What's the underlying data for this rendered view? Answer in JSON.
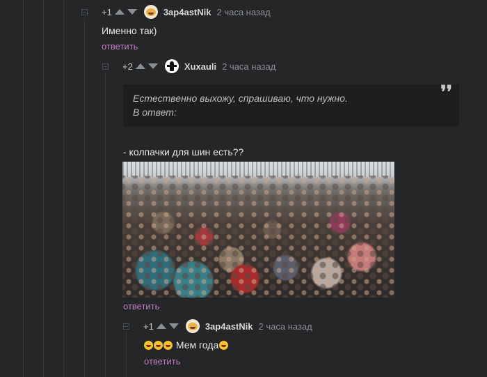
{
  "comments": [
    {
      "rating": "+1",
      "username": "3ap4astNik",
      "time": "2 часа назад",
      "text": "Именно так)",
      "reply_label": "ответить",
      "avatar_icon": "laughing-face-avatar"
    },
    {
      "rating": "+2",
      "username": "Xuxauli",
      "time": "2 часа назад",
      "quote_lines": [
        "Естественно выхожу, спрашиваю, что нужно.",
        "В ответ:"
      ],
      "quote_mark": "❜❜",
      "text": "- колпачки для шин есть??",
      "image_icon": "crowd-of-elderly-people-photo",
      "reply_label": "ответить",
      "avatar_icon": "figure-logo-avatar"
    },
    {
      "rating": "+1",
      "username": "3ap4astNik",
      "time": "2 часа назад",
      "text": "Мем года",
      "emojis": [
        "grinning-emoji",
        "grinning-emoji",
        "grinning-emoji",
        "laughing-tears-emoji"
      ],
      "reply_label": "ответить",
      "avatar_icon": "laughing-face-avatar"
    }
  ],
  "colors": {
    "background": "#252628",
    "reply_link": "#bf7fc4",
    "quote_bg": "#1d1e20"
  }
}
